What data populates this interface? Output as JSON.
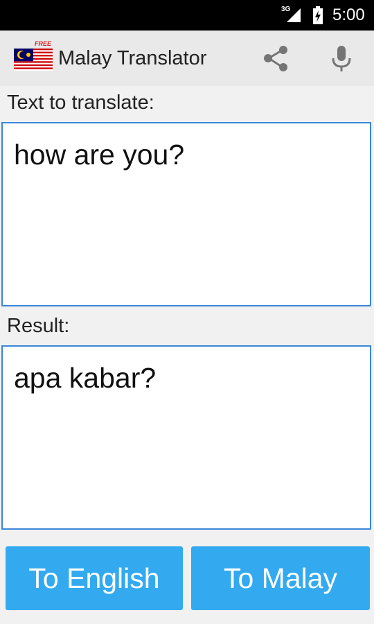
{
  "status_bar": {
    "network": "3G",
    "time": "5:00"
  },
  "app": {
    "title": "Malay Translator",
    "badge": "FREE"
  },
  "source": {
    "label": "Text to translate:",
    "text": "how are you?"
  },
  "result": {
    "label": "Result:",
    "text": "apa kabar?"
  },
  "buttons": {
    "to_english": "To English",
    "to_malay": "To Malay"
  },
  "colors": {
    "accent": "#33aaf0",
    "field_border": "#3b86d8",
    "status_bar": "#000000"
  },
  "icons": [
    "signal-icon",
    "battery-charging-icon",
    "malaysia-flag-icon",
    "share-icon",
    "microphone-icon"
  ]
}
